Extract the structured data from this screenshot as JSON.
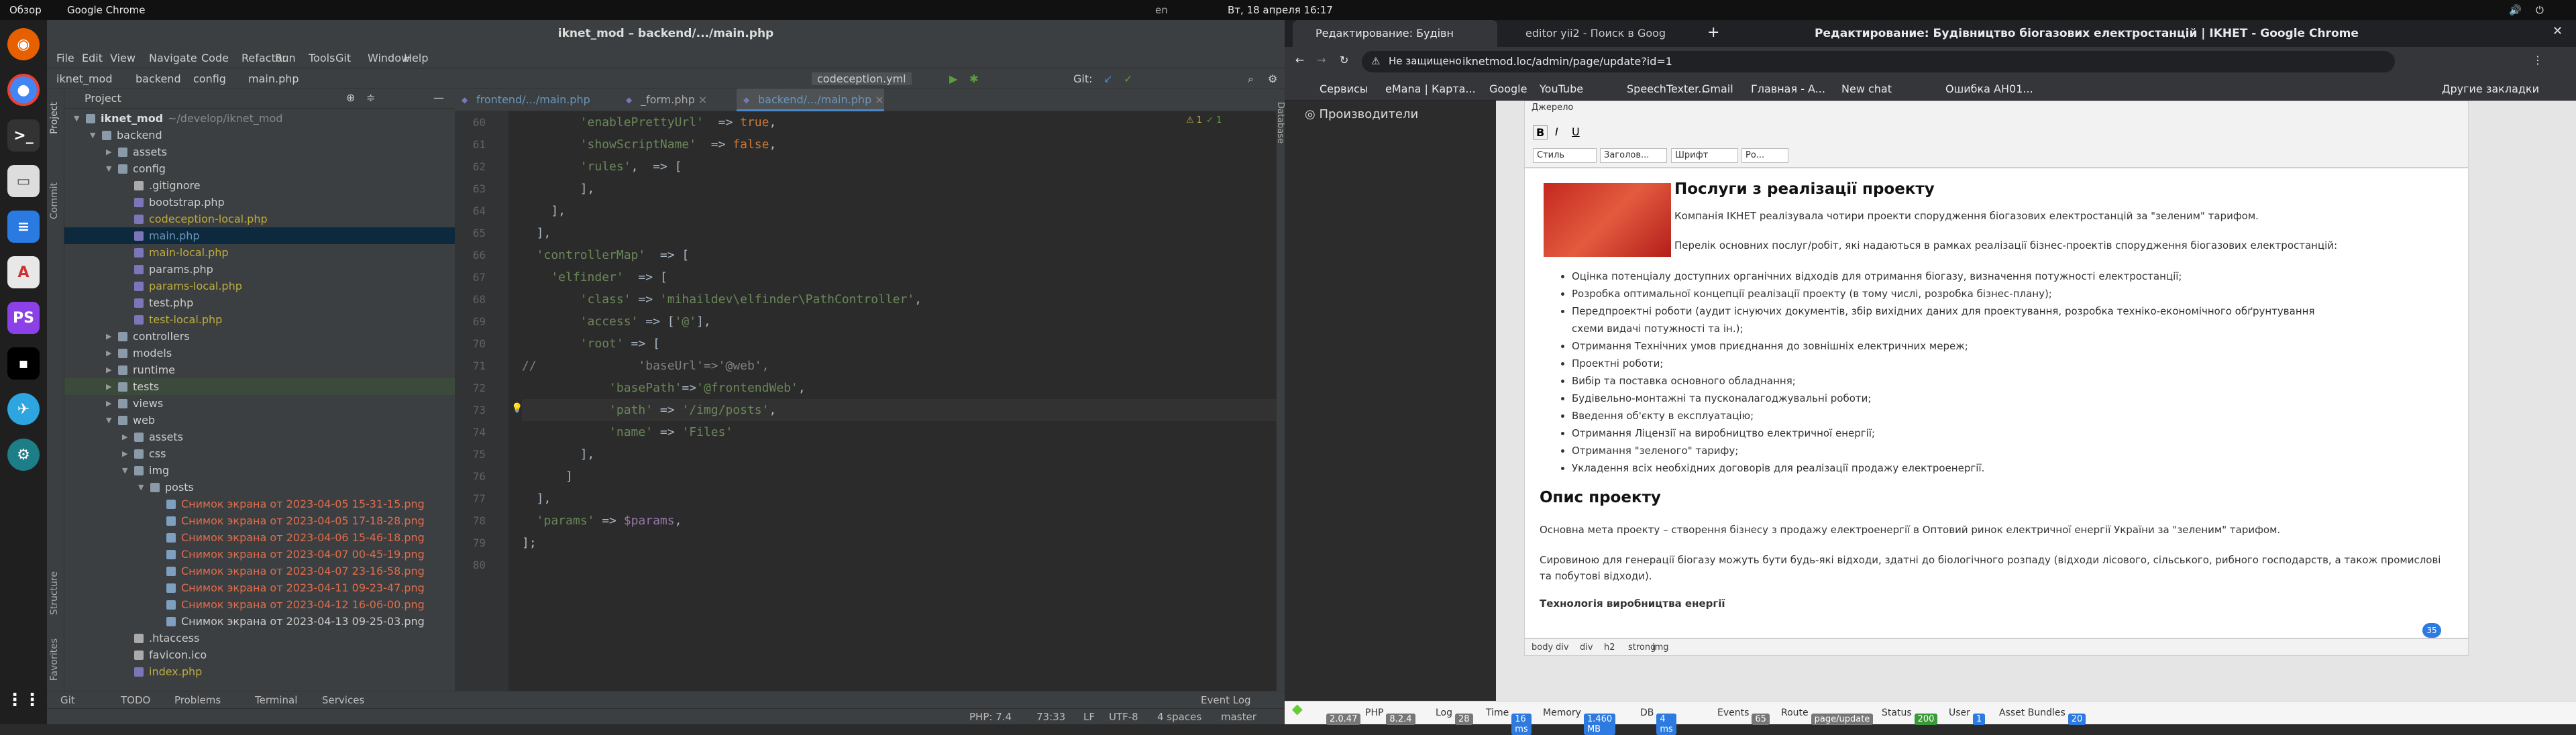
{
  "topbar": {
    "overview": "Обзор",
    "app": "Google Chrome",
    "datetime": "Вт, 18 апреля  16:17",
    "lang": "en"
  },
  "ide": {
    "title": "iknet_mod – backend/.../main.php",
    "menu": [
      "File",
      "Edit",
      "View",
      "Navigate",
      "Code",
      "Refactor",
      "Run",
      "Tools",
      "Git",
      "Window",
      "Help"
    ],
    "crumbs": [
      "iknet_mod",
      "backend",
      "config",
      "main.php"
    ],
    "run_config": "codeception.yml",
    "git_label": "Git:",
    "project_label": "Project",
    "side_tabs": [
      "Project",
      "Commit",
      "Structure",
      "Favorites"
    ],
    "tree": [
      {
        "name": "iknet_mod",
        "extra": "~/develop/iknet_mod",
        "depth": 0,
        "type": "dir",
        "open": true,
        "color": "#ddd",
        "bold": true
      },
      {
        "name": "backend",
        "depth": 1,
        "type": "dir",
        "open": true,
        "color": "#ccc"
      },
      {
        "name": "assets",
        "depth": 2,
        "type": "dir",
        "open": false,
        "color": "#ccc"
      },
      {
        "name": "config",
        "depth": 2,
        "type": "dir",
        "open": true,
        "color": "#ccc"
      },
      {
        "name": ".gitignore",
        "depth": 3,
        "type": "file",
        "color": "#ccc"
      },
      {
        "name": "bootstrap.php",
        "depth": 3,
        "type": "php",
        "color": "#ccc"
      },
      {
        "name": "codeception-local.php",
        "depth": 3,
        "type": "php",
        "color": "#bfae3b"
      },
      {
        "name": "main.php",
        "depth": 3,
        "type": "php",
        "color": "#6897bb",
        "selected": true
      },
      {
        "name": "main-local.php",
        "depth": 3,
        "type": "php",
        "color": "#bfae3b"
      },
      {
        "name": "params.php",
        "depth": 3,
        "type": "php",
        "color": "#ccc"
      },
      {
        "name": "params-local.php",
        "depth": 3,
        "type": "php",
        "color": "#bfae3b"
      },
      {
        "name": "test.php",
        "depth": 3,
        "type": "php",
        "color": "#ccc"
      },
      {
        "name": "test-local.php",
        "depth": 3,
        "type": "php",
        "color": "#bfae3b"
      },
      {
        "name": "controllers",
        "depth": 2,
        "type": "dir",
        "open": false,
        "color": "#ccc"
      },
      {
        "name": "models",
        "depth": 2,
        "type": "dir",
        "open": false,
        "color": "#ccc"
      },
      {
        "name": "runtime",
        "depth": 2,
        "type": "dir",
        "open": false,
        "color": "#ccc"
      },
      {
        "name": "tests",
        "depth": 2,
        "type": "dir",
        "open": false,
        "color": "#ccc",
        "highlight": true
      },
      {
        "name": "views",
        "depth": 2,
        "type": "dir",
        "open": false,
        "color": "#ccc"
      },
      {
        "name": "web",
        "depth": 2,
        "type": "dir",
        "open": true,
        "color": "#ccc"
      },
      {
        "name": "assets",
        "depth": 3,
        "type": "dir",
        "open": false,
        "color": "#ccc"
      },
      {
        "name": "css",
        "depth": 3,
        "type": "dir",
        "open": false,
        "color": "#ccc"
      },
      {
        "name": "img",
        "depth": 3,
        "type": "dir",
        "open": true,
        "color": "#ccc"
      },
      {
        "name": "posts",
        "depth": 4,
        "type": "dir",
        "open": true,
        "color": "#ccc"
      },
      {
        "name": "Снимок экрана от 2023-04-05 15-31-15.png",
        "depth": 5,
        "type": "img",
        "color": "#e06c4b"
      },
      {
        "name": "Снимок экрана от 2023-04-05 17-18-28.png",
        "depth": 5,
        "type": "img",
        "color": "#e06c4b"
      },
      {
        "name": "Снимок экрана от 2023-04-06 15-46-18.png",
        "depth": 5,
        "type": "img",
        "color": "#e06c4b"
      },
      {
        "name": "Снимок экрана от 2023-04-07 00-45-19.png",
        "depth": 5,
        "type": "img",
        "color": "#e06c4b"
      },
      {
        "name": "Снимок экрана от 2023-04-07 23-16-58.png",
        "depth": 5,
        "type": "img",
        "color": "#e06c4b"
      },
      {
        "name": "Снимок экрана от 2023-04-11 09-23-47.png",
        "depth": 5,
        "type": "img",
        "color": "#e06c4b"
      },
      {
        "name": "Снимок экрана от 2023-04-12 16-06-00.png",
        "depth": 5,
        "type": "img",
        "color": "#e06c4b"
      },
      {
        "name": "Снимок экрана от 2023-04-13 09-25-03.png",
        "depth": 5,
        "type": "img",
        "color": "#ccc"
      },
      {
        "name": ".htaccess",
        "depth": 3,
        "type": "file",
        "color": "#ccc"
      },
      {
        "name": "favicon.ico",
        "depth": 3,
        "type": "file",
        "color": "#ccc"
      },
      {
        "name": "index.php",
        "depth": 3,
        "type": "php",
        "color": "#bfae3b"
      }
    ],
    "tabs": [
      "frontend/.../main.php",
      "_form.php",
      "backend/.../main.php"
    ],
    "active_tab": 2,
    "warnings": "1",
    "weak": "1",
    "lines": [
      {
        "n": "60",
        "segs": [
          [
            "s",
            "        'enablePrettyUrl'"
          ],
          [
            "",
            "  => "
          ],
          [
            "k",
            "true"
          ],
          [
            "",
            ","
          ]
        ]
      },
      {
        "n": "61",
        "segs": [
          [
            "s",
            "        'showScriptName'"
          ],
          [
            "",
            "  => "
          ],
          [
            "k",
            "false"
          ],
          [
            "",
            ","
          ]
        ]
      },
      {
        "n": "62",
        "segs": [
          [
            "s",
            "        'rules'"
          ],
          [
            "",
            ","
          ],
          [
            "",
            "  => ["
          ]
        ]
      },
      {
        "n": "63",
        "segs": [
          [
            "",
            "        ],"
          ]
        ]
      },
      {
        "n": "64",
        "segs": [
          [
            "",
            "    ],"
          ]
        ]
      },
      {
        "n": "65",
        "segs": [
          [
            "",
            "  ],"
          ]
        ]
      },
      {
        "n": "66",
        "segs": [
          [
            "s",
            "  'controllerMap'"
          ],
          [
            "",
            "  => ["
          ]
        ]
      },
      {
        "n": "67",
        "segs": [
          [
            "s",
            "    'elfinder'"
          ],
          [
            "",
            "  => ["
          ]
        ]
      },
      {
        "n": "68",
        "segs": [
          [
            "s",
            "        'class'"
          ],
          [
            "",
            " => "
          ],
          [
            "s",
            "'mihaildev\\elfinder\\PathController'"
          ],
          [
            "",
            ","
          ]
        ]
      },
      {
        "n": "69",
        "segs": [
          [
            "s",
            "        'access'"
          ],
          [
            "",
            " => ["
          ],
          [
            "s",
            "'@'"
          ],
          [
            "",
            "],"
          ]
        ]
      },
      {
        "n": "70",
        "segs": [
          [
            "s",
            "        'root'"
          ],
          [
            "",
            " => ["
          ]
        ]
      },
      {
        "n": "71",
        "segs": [
          [
            "c",
            "//              'baseUrl'=>'@web',"
          ]
        ]
      },
      {
        "n": "72",
        "segs": [
          [
            "s",
            "            'basePath'"
          ],
          [
            "",
            "=>"
          ],
          [
            "s",
            "'@frontendWeb'"
          ],
          [
            "",
            ","
          ]
        ]
      },
      {
        "n": "73",
        "segs": [
          [
            "s",
            "            'path'"
          ],
          [
            "",
            " => "
          ],
          [
            "s",
            "'/img/posts'"
          ],
          [
            "",
            ","
          ]
        ]
      },
      {
        "n": "74",
        "segs": [
          [
            "s",
            "            'name'"
          ],
          [
            "",
            " => "
          ],
          [
            "s",
            "'Files'"
          ]
        ]
      },
      {
        "n": "75",
        "segs": [
          [
            "",
            "        ],"
          ]
        ]
      },
      {
        "n": "76",
        "segs": [
          [
            "",
            "      ]"
          ]
        ]
      },
      {
        "n": "77",
        "segs": [
          [
            "",
            "  ],"
          ]
        ]
      },
      {
        "n": "78",
        "segs": [
          [
            "s",
            "  'params'"
          ],
          [
            "",
            " => "
          ],
          [
            "v",
            "$params"
          ],
          [
            "",
            ","
          ]
        ]
      },
      {
        "n": "79",
        "segs": [
          [
            "",
            "];"
          ]
        ]
      },
      {
        "n": "80",
        "segs": [
          [
            "",
            ""
          ]
        ]
      }
    ],
    "database_label": "Database",
    "bottom_tabs": [
      "Git",
      "TODO",
      "Problems",
      "Terminal",
      "Services"
    ],
    "event_log": "Event Log",
    "status": {
      "php": "PHP: 7.4",
      "pos": "73:33",
      "lf": "LF",
      "enc": "UTF-8",
      "indent": "4 spaces",
      "branch": "master"
    }
  },
  "chrome": {
    "title": "Редактирование: Будівництво біогазових електростанцій | IKHET - Google Chrome",
    "tabs": [
      "Редактирование: Будівн",
      "editor yii2 - Поиск в Goog"
    ],
    "insecure": "Не защищено",
    "url": "iknetmod.loc/admin/page/update?id=1",
    "bookmarks": [
      "Сервисы",
      "eMana | Карта...",
      "Google",
      "YouTube",
      "SpeechTexter...",
      "Gmail",
      "Главная - A...",
      "New chat",
      "Ошибка AH01..."
    ],
    "other_bookmarks": "Другие закладки",
    "admin_menu_item": "Производители",
    "ck": {
      "source": "Джерело",
      "style": "Стиль",
      "format": "Заголов...",
      "font": "Шрифт",
      "size": "Ро..."
    },
    "content": {
      "h2a": "Послуги з реалізації проекту",
      "p1": "Компанія IKHET реалізувала чотири проекти спорудження біогазових електростанцій за \"зеленим\" тарифом.",
      "p2": "Перелік основних послуг/робіт, які надаються в рамках реалізації бізнес-проектів спорудження біогазових електростанцій:",
      "items": [
        "Оцінка потенціалу доступних органічних відходів для отримання біогазу, визначення потужності електростанції;",
        "Розробка оптимальної концепції реалізації проекту (в тому числі, розробка бізнес-плану);",
        "Передпроектні роботи (аудит існуючих документів, збір вихідних даних для проектування, розробка техніко-економічного обґрунтування схеми видачі потужності та ін.);",
        "Отримання Технічних умов приєднання до зовнішніх електричних мереж;",
        "Проектні роботи;",
        "Вибір та поставка основного обладнання;",
        "Будівельно-монтажні та пусконалагоджувальні роботи;",
        "Введення об'єкту в експлуатацію;",
        "Отримання Ліцензії на виробництво електричної енергії;",
        "Отримання \"зеленого\" тарифу;",
        "Укладення всіх необхідних договорів для реалізації продажу електроенергії."
      ],
      "h2b": "Опис проекту",
      "p3": "Основна мета проекту – створення бізнесу з продажу електроенергії в Оптовий ринок електричної енергії України за \"зеленим\" тарифом.",
      "p4": "Сировиною для генерації біогазу можуть бути будь-які відходи, здатні до біологічного розпаду (відходи лісового, сільського, рибного господарств, а також промислові та побутові відходи).",
      "h3": "Технологія виробництва енергії",
      "badge": "35"
    },
    "path": [
      "body",
      "div",
      "div",
      "h2",
      "strong",
      "img"
    ],
    "debug": {
      "ver": "2.0.47",
      "php": "8.2.4",
      "log": "28",
      "time": "16 ms",
      "memory": "1.460 MB",
      "db": "9",
      "db_time": "4 ms",
      "events": "65",
      "route": "page/update",
      "status": "200",
      "user": "1",
      "bundles": "20"
    }
  },
  "colors": {
    "accent": "#4a88c7",
    "warn": "#e06c4b",
    "modified": "#bfae3b"
  }
}
